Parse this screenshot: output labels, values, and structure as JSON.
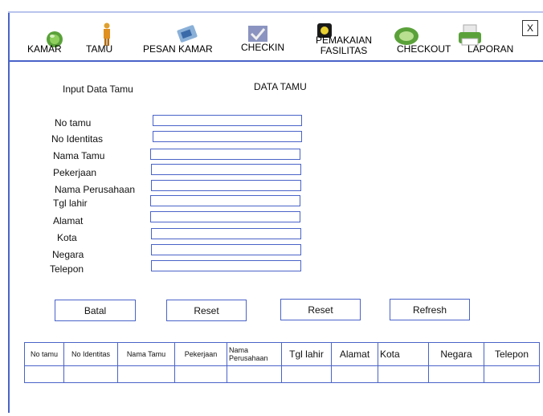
{
  "toolbar": {
    "items": [
      {
        "label": "KAMAR",
        "icon": "green-ball-icon"
      },
      {
        "label": "TAMU",
        "icon": "person-icon"
      },
      {
        "label": "PESAN KAMAR",
        "icon": "phone-booking-icon"
      },
      {
        "label": "CHECKIN",
        "icon": "checkin-icon"
      },
      {
        "label": "PEMAKAIAN FASILITAS",
        "icon": "facility-icon"
      },
      {
        "label": "CHECKOUT",
        "icon": "checkout-icon"
      },
      {
        "label": "LAPORAN",
        "icon": "printer-icon"
      }
    ],
    "close_label": "X"
  },
  "form": {
    "heading": "Input Data Tamu",
    "fields": [
      {
        "label": "No tamu",
        "value": ""
      },
      {
        "label": "No Identitas",
        "value": ""
      },
      {
        "label": "Nama Tamu",
        "value": ""
      },
      {
        "label": "Pekerjaan",
        "value": ""
      },
      {
        "label": "Nama Perusahaan",
        "value": ""
      },
      {
        "label": "Tgl lahir",
        "value": ""
      },
      {
        "label": "Alamat",
        "value": ""
      },
      {
        "label": "Kota",
        "value": ""
      },
      {
        "label": "Negara",
        "value": ""
      },
      {
        "label": "Telepon",
        "value": ""
      }
    ],
    "buttons": {
      "batal": "Batal",
      "reset1": "Reset",
      "reset2": "Reset",
      "refresh": "Refresh"
    }
  },
  "table": {
    "title": "DATA TAMU",
    "columns": [
      "No tamu",
      "No Identitas",
      "Nama Tamu",
      "Pekerjaan",
      "Nama Perusahaan",
      "Tgl lahir",
      "Alamat",
      "Kota",
      "Negara",
      "Telepon"
    ]
  },
  "colors": {
    "border": "#4a63c8"
  }
}
